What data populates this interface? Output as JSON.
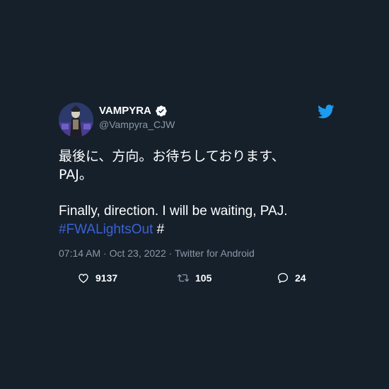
{
  "tweet": {
    "display_name": "VAMPYRA",
    "handle": "@Vampyra_CJW",
    "text_lines": {
      "ja_1": "最後に、方向。お待ちしております、",
      "ja_2": "PAJ。",
      "en_1": "Finally, direction. I will be waiting, PAJ.",
      "hashtag": "#FWALightsOut",
      "hash_suffix": " #"
    },
    "meta": "07:14 AM · Oct 23, 2022 · Twitter for Android",
    "likes": "9137",
    "retweets": "105",
    "replies": "24"
  },
  "icons": {
    "verified": "verified-badge-icon",
    "bird": "twitter-bird-icon",
    "like": "heart-icon",
    "retweet": "retweet-icon",
    "reply": "reply-icon"
  },
  "colors": {
    "background": "#15202b",
    "text": "#ffffff",
    "secondary": "#8b98a5",
    "hashtag": "#3b62d6",
    "brand": "#1d9bf0"
  }
}
